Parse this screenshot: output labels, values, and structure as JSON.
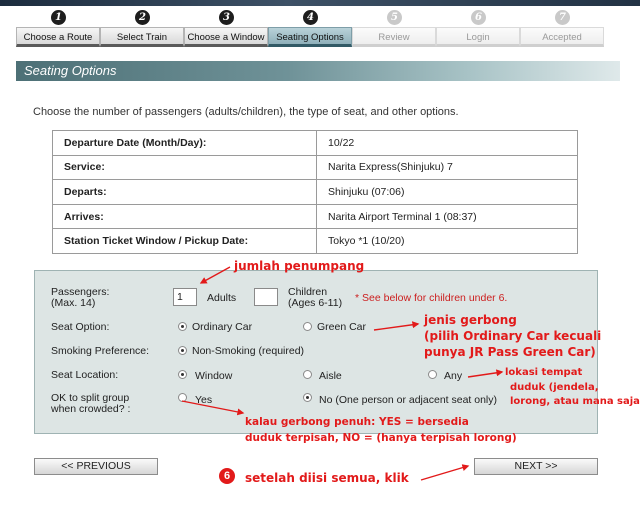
{
  "steps": [
    {
      "num": "1",
      "label": "Choose a Route",
      "state": "done"
    },
    {
      "num": "2",
      "label": "Select Train",
      "state": "done"
    },
    {
      "num": "3",
      "label": "Choose a Window",
      "state": "done"
    },
    {
      "num": "4",
      "label": "Seating Options",
      "state": "current"
    },
    {
      "num": "5",
      "label": "Review",
      "state": "upcoming"
    },
    {
      "num": "6",
      "label": "Login",
      "state": "upcoming"
    },
    {
      "num": "7",
      "label": "Accepted",
      "state": "upcoming"
    }
  ],
  "section_title": "Seating Options",
  "intro": "Choose the number of passengers (adults/children), the type of seat, and other options.",
  "trip": [
    {
      "label": "Departure Date (Month/Day):",
      "value": "10/22"
    },
    {
      "label": "Service:",
      "value": "Narita Express(Shinjuku) 7"
    },
    {
      "label": "Departs:",
      "value": "Shinjuku (07:06)"
    },
    {
      "label": "Arrives:",
      "value": "Narita Airport Terminal 1 (08:37)"
    },
    {
      "label": "Station Ticket Window / Pickup Date:",
      "value": "Tokyo *1 (10/20)"
    }
  ],
  "form": {
    "passengers_label": "Passengers:",
    "passengers_max": "(Max. 14)",
    "adults_value": "1",
    "adults_label": "Adults",
    "children_value": "",
    "children_label": "Children",
    "children_ages": "(Ages 6-11)",
    "children_note": "* See below for children under 6.",
    "seat_option_label": "Seat Option:",
    "seat_option_ordinary": "Ordinary Car",
    "seat_option_green": "Green Car",
    "seat_option_selected": "Ordinary Car",
    "smoking_label": "Smoking Preference:",
    "smoking_value": "Non-Smoking (required)",
    "location_label": "Seat Location:",
    "location_window": "Window",
    "location_aisle": "Aisle",
    "location_any": "Any",
    "location_selected": "Window",
    "split_label_1": "OK to split group",
    "split_label_2": "when crowded? :",
    "split_yes": "Yes",
    "split_no": "No (One person or adjacent seat only)",
    "split_selected": "No"
  },
  "buttons": {
    "previous": "<< PREVIOUS",
    "next": "NEXT >>"
  },
  "annotations": {
    "passengers": "jumlah penumpang",
    "car_1": "jenis gerbong",
    "car_2": "(pilih Ordinary Car kecuali",
    "car_3": "punya JR Pass Green Car)",
    "loc_1": "lokasi tempat",
    "loc_2": "duduk (jendela,",
    "loc_3": "lorong, atau mana saja)",
    "split_1": "kalau gerbong penuh: YES = bersedia",
    "split_2": "duduk terpisah, NO = (hanya terpisah lorong)",
    "step_num": "6",
    "click": "setelah diisi semua, klik"
  },
  "colors": {
    "annotation": "#e21a1a",
    "current_step": "#9dbcc5",
    "section_title": "#5d7f85",
    "form_bg": "#dde5e4"
  }
}
